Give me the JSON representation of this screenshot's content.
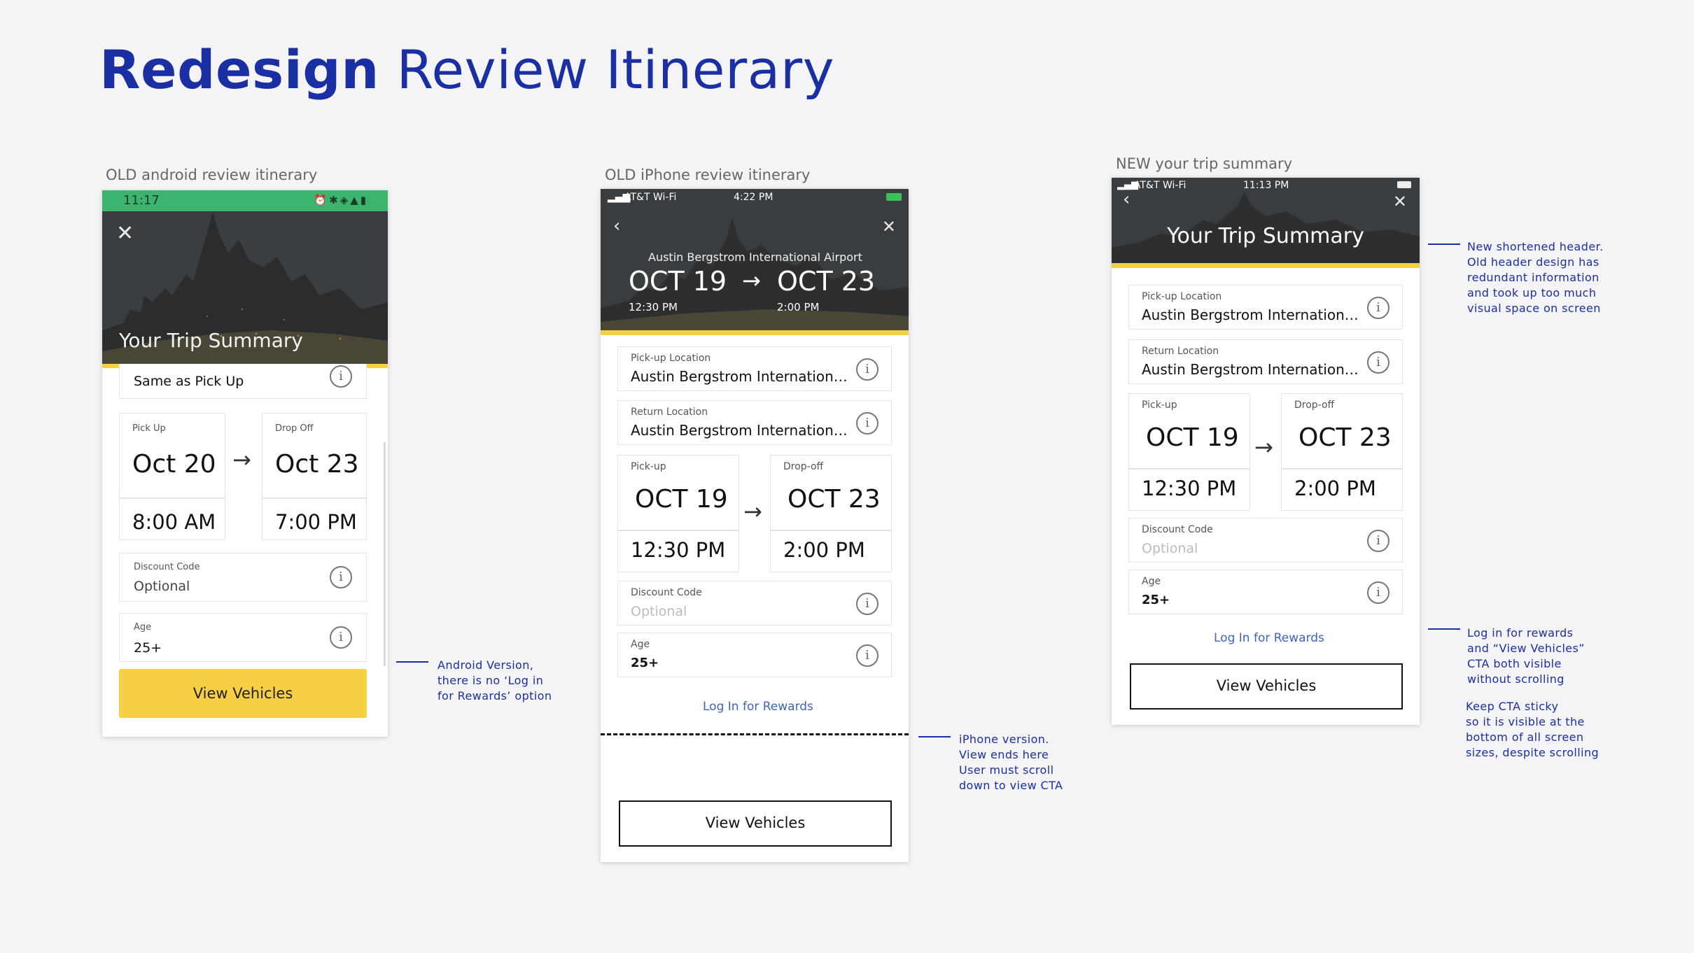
{
  "title": {
    "bold": "Redesign",
    "rest": "Review Itinerary"
  },
  "android": {
    "label": "OLD android review itinerary",
    "status_time": "11:17",
    "header_title": "Your Trip Summary",
    "return_value": "Same as Pick Up",
    "pickup_label": "Pick Up",
    "pickup_date": "Oct 20",
    "pickup_time": "8:00 AM",
    "dropoff_label": "Drop Off",
    "dropoff_date": "Oct 23",
    "dropoff_time": "7:00 PM",
    "discount_label": "Discount Code",
    "discount_value": "Optional",
    "age_label": "Age",
    "age_value": "25+",
    "cta": "View Vehicles",
    "accent": "#f7cf45",
    "statusbar_color": "#3cb46e"
  },
  "iphone_old": {
    "label": "OLD iPhone review itinerary",
    "carrier": "AT&T Wi-Fi",
    "status_time": "4:22 PM",
    "airport": "Austin Bergstrom International Airport",
    "start_date": "OCT 19",
    "start_time": "12:30 PM",
    "end_date": "OCT 23",
    "end_time": "2:00 PM",
    "pickup_location_label": "Pick-up Location",
    "pickup_location_value": "Austin Bergstrom International Airport",
    "return_location_label": "Return Location",
    "return_location_value": "Austin Bergstrom International Airport",
    "pickup_label": "Pick-up",
    "pickup_date": "OCT 19",
    "pickup_time": "12:30 PM",
    "dropoff_label": "Drop-off",
    "dropoff_date": "OCT 23",
    "dropoff_time": "2:00 PM",
    "discount_label": "Discount Code",
    "discount_placeholder": "Optional",
    "age_label": "Age",
    "age_value": "25+",
    "rewards_link": "Log In for Rewards",
    "cta": "View Vehicles"
  },
  "iphone_new": {
    "label": "NEW your trip summary",
    "carrier": "AT&T Wi-Fi",
    "status_time": "11:13 PM",
    "header_title": "Your Trip Summary",
    "pickup_location_label": "Pick-up Location",
    "pickup_location_value": "Austin Bergstrom International Airport",
    "return_location_label": "Return Location",
    "return_location_value": "Austin Bergstrom International Airport",
    "pickup_label": "Pick-up",
    "pickup_date": "OCT 19",
    "pickup_time": "12:30 PM",
    "dropoff_label": "Drop-off",
    "dropoff_date": "OCT 23",
    "dropoff_time": "2:00 PM",
    "discount_label": "Discount Code",
    "discount_placeholder": "Optional",
    "age_label": "Age",
    "age_value": "25+",
    "rewards_link": "Log In for Rewards",
    "cta": "View Vehicles"
  },
  "notes": {
    "android": [
      "Android Version,",
      "there is no ‘Log in",
      "for Rewards’ option"
    ],
    "iphone": [
      "iPhone version.",
      "View ends here",
      "User must scroll",
      "down to view CTA"
    ],
    "header": [
      "New shortened header.",
      "Old header design has",
      "redundant information",
      "and took up too much",
      "visual space on screen"
    ],
    "rewards": [
      "Log in for rewards",
      "and “View Vehicles”",
      "CTA both visible",
      "without scrolling"
    ],
    "sticky": [
      "Keep CTA sticky",
      "so it is visible at the",
      "bottom of all screen",
      "sizes, despite scrolling"
    ]
  }
}
